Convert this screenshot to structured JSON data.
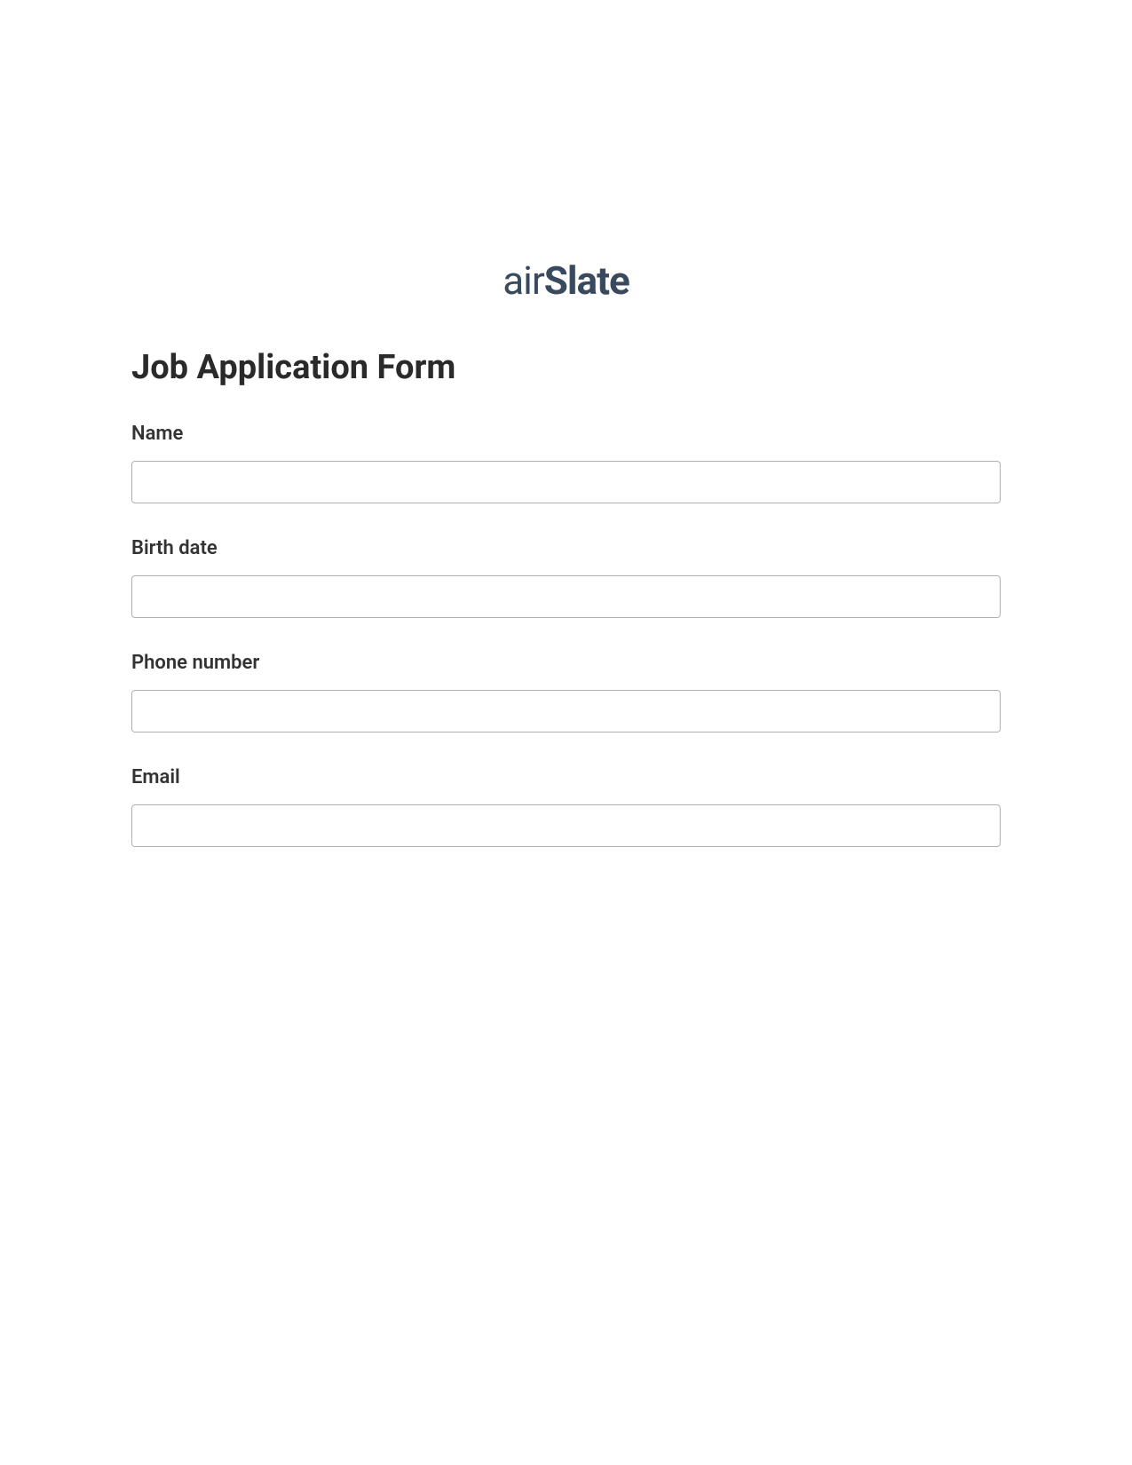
{
  "logo": {
    "prefix": "air",
    "suffix": "Slate"
  },
  "form": {
    "title": "Job Application Form",
    "fields": [
      {
        "label": "Name",
        "value": ""
      },
      {
        "label": "Birth date",
        "value": ""
      },
      {
        "label": "Phone number",
        "value": ""
      },
      {
        "label": "Email",
        "value": ""
      }
    ]
  }
}
